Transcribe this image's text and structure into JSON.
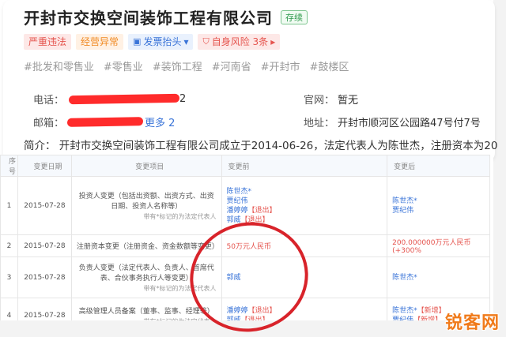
{
  "company": {
    "name": "开封市交换空间装饰工程有限公司",
    "status": "存续"
  },
  "tags": [
    {
      "label": "严重违法"
    },
    {
      "label": "经营异常"
    },
    {
      "label": "发票抬头",
      "icon": "invoice-icon"
    },
    {
      "label": "自身风险 3条",
      "icon": "shield-icon"
    }
  ],
  "industries": [
    "#批发和零售业",
    "#零售业",
    "#装饰工程",
    "#河南省",
    "#开封市",
    "#鼓楼区"
  ],
  "contact": {
    "phone_label": "电话：",
    "phone_tail": "2",
    "email_label": "邮箱：",
    "email_more": "更多 2",
    "website_label": "官网：",
    "website_value": "暂无",
    "address_label": "地址：",
    "address_value": "开封市顺河区公园路47号付7号"
  },
  "description": {
    "label": "简介：",
    "text": "开封市交换空间装饰工程有限公司成立于2014-06-26，法定代表人为陈世杰，注册资本为20"
  },
  "table": {
    "headers": [
      "序号",
      "变更日期",
      "变更项目",
      "变更前",
      "变更后"
    ],
    "note": "带有*标记的为法定代表人",
    "rows": [
      {
        "idx": "1",
        "date": "2015-07-28",
        "item": "投资人变更（包括出资额、出资方式、出资日期、投资人名称等）",
        "before": [
          {
            "name": "陈世杰*",
            "tag": ""
          },
          {
            "name": "贾纪伟",
            "tag": ""
          },
          {
            "name": "潘婷婷",
            "tag": "【退出】"
          },
          {
            "name": "郭威",
            "tag": "【退出】"
          }
        ],
        "after": [
          {
            "name": "陈世杰*",
            "tag": ""
          },
          {
            "name": "贾纪伟",
            "tag": ""
          }
        ]
      },
      {
        "idx": "2",
        "date": "2015-07-28",
        "item": "注册资本变更（注册资金、资金数额等变更）",
        "before": [
          {
            "name": "50万元人民币",
            "tag": ""
          }
        ],
        "after_text": "200.000000万元人民币(+300%"
      },
      {
        "idx": "3",
        "date": "2015-07-28",
        "item": "负责人变更（法定代表人、负责人、首席代表、合伙事务执行人等变更）",
        "before": [
          {
            "name": "郭威",
            "tag": ""
          }
        ],
        "after": [
          {
            "name": "陈世杰*",
            "tag": ""
          }
        ]
      },
      {
        "idx": "4",
        "date": "2015-07-28",
        "item": "高级管理人员备案（董事、监事、经理等）",
        "before": [
          {
            "name": "潘婷婷",
            "tag": "【退出】"
          },
          {
            "name": "郭威",
            "tag": "【退出】"
          }
        ],
        "after": [
          {
            "name": "陈世杰*",
            "tag": "【新增】"
          },
          {
            "name": "贾纪伟",
            "tag": "【新增】"
          }
        ]
      }
    ]
  },
  "watermark": "锐客网",
  "colors": {
    "red": "#e5544e",
    "blue": "#3a74d8",
    "green": "#2e9a4c",
    "orange": "#f08a24",
    "circle": "#d8232a"
  }
}
